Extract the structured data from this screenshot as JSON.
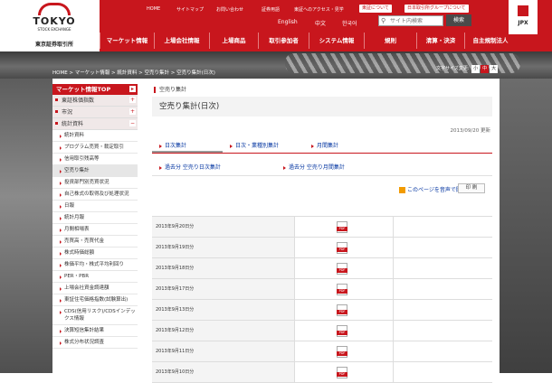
{
  "header": {
    "logo": {
      "word": "TOKYO",
      "sub": "STOCK EXCHANGE",
      "jp": "東京証券取引所"
    },
    "top_links": [
      "HOME",
      "サイトマップ",
      "お問い合わせ",
      "証券用語",
      "東証へのアクセス・見学"
    ],
    "pills": [
      "東証について",
      "日本取引所グループについて"
    ],
    "languages": [
      "English",
      "中文",
      "한국어"
    ],
    "search": {
      "placeholder": "サイト内検索",
      "button": "検索"
    },
    "jpx": "JPX",
    "main_nav": [
      "マーケット情報",
      "上場会社情報",
      "上場商品",
      "取引参加者",
      "システム情報",
      "規則",
      "清算・決済",
      "自主規制法人"
    ],
    "accent": "#c8161d"
  },
  "breadcrumb": "HOME > マーケット情報 > 統計資料 > 空売り集計 > 空売り集計(日次)",
  "font_size": {
    "label": "文字サイズ変更:",
    "options": [
      "小",
      "中",
      "大"
    ],
    "selected": "中"
  },
  "sidebar": {
    "top": {
      "label": "マーケット情報TOP",
      "toggle": "▸"
    },
    "sections": [
      {
        "label": "東証株価指数",
        "toggle": "+"
      },
      {
        "label": "市況",
        "toggle": "+"
      },
      {
        "label": "統計資料",
        "toggle": "−"
      }
    ],
    "items": [
      "統計資料",
      "プログラム売買・裁定取引",
      "信用取引残高等",
      "空売り集計",
      "投資部門別売買状況",
      "自己株式の取得及び処理状況",
      "日報",
      "統計月報",
      "月間相場表",
      "売買高・売買代金",
      "株式時価総額",
      "株価平均・株式平均利回り",
      "PER・PBR",
      "上場会社資金調達額",
      "東証住宅価格指数(試験算出)",
      "CDS(信用リスク)/CDSインデックス情報",
      "決算短信集計結果",
      "株式分布状況調査"
    ],
    "active_item": "空売り集計"
  },
  "main": {
    "title_small": "空売り集計",
    "title": "空売り集計(日次)",
    "updated": "2013/09/20 更新",
    "tabs": [
      "日次集計",
      "日次・業種別集計",
      "月間集計"
    ],
    "subtabs": [
      "過去分 空売り日次集計",
      "過去分 空売り月間集計"
    ],
    "speak": "このページを音声で聞く",
    "print": "印 刷",
    "rows": [
      {
        "date": "2013年9月20日分",
        "file": "PDF"
      },
      {
        "date": "2013年9月19日分",
        "file": "PDF"
      },
      {
        "date": "2013年9月18日分",
        "file": "PDF"
      },
      {
        "date": "2013年9月17日分",
        "file": "PDF"
      },
      {
        "date": "2013年9月13日分",
        "file": "PDF"
      },
      {
        "date": "2013年9月12日分",
        "file": "PDF"
      },
      {
        "date": "2013年9月11日分",
        "file": "PDF"
      },
      {
        "date": "2013年9月10日分",
        "file": "PDF"
      }
    ]
  }
}
